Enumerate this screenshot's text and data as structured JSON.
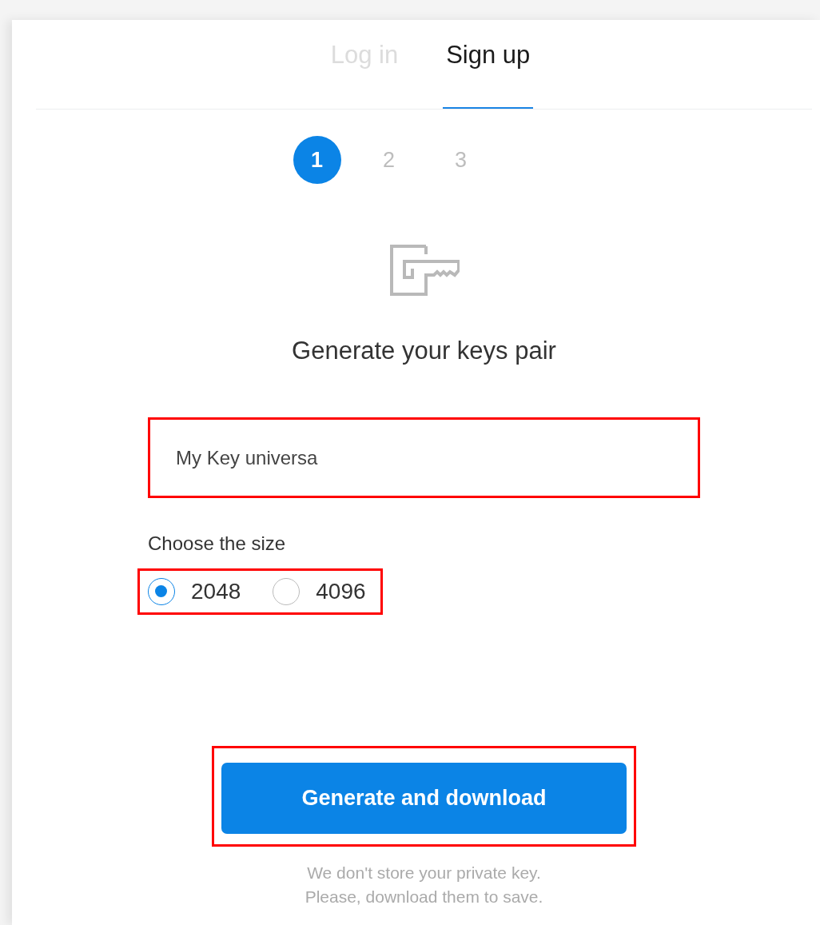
{
  "tabs": [
    {
      "label": "Log in",
      "selected": false
    },
    {
      "label": "Sign up",
      "selected": true
    }
  ],
  "steps": [
    {
      "label": "1",
      "selected": true
    },
    {
      "label": "2",
      "selected": false
    },
    {
      "label": "3",
      "selected": false
    }
  ],
  "title": "Generate your keys pair",
  "key_name_field": {
    "value": "My Key universa",
    "highlighted": true
  },
  "size_label": "Choose the size",
  "size_options": {
    "highlighted": true,
    "items": [
      {
        "label": "2048",
        "selected": true
      },
      {
        "label": "4096",
        "selected": false
      }
    ]
  },
  "generate_button": {
    "label": "Generate and download",
    "highlighted": true
  },
  "footnote": [
    "We don't store your private key.",
    "Please, download them to save."
  ]
}
